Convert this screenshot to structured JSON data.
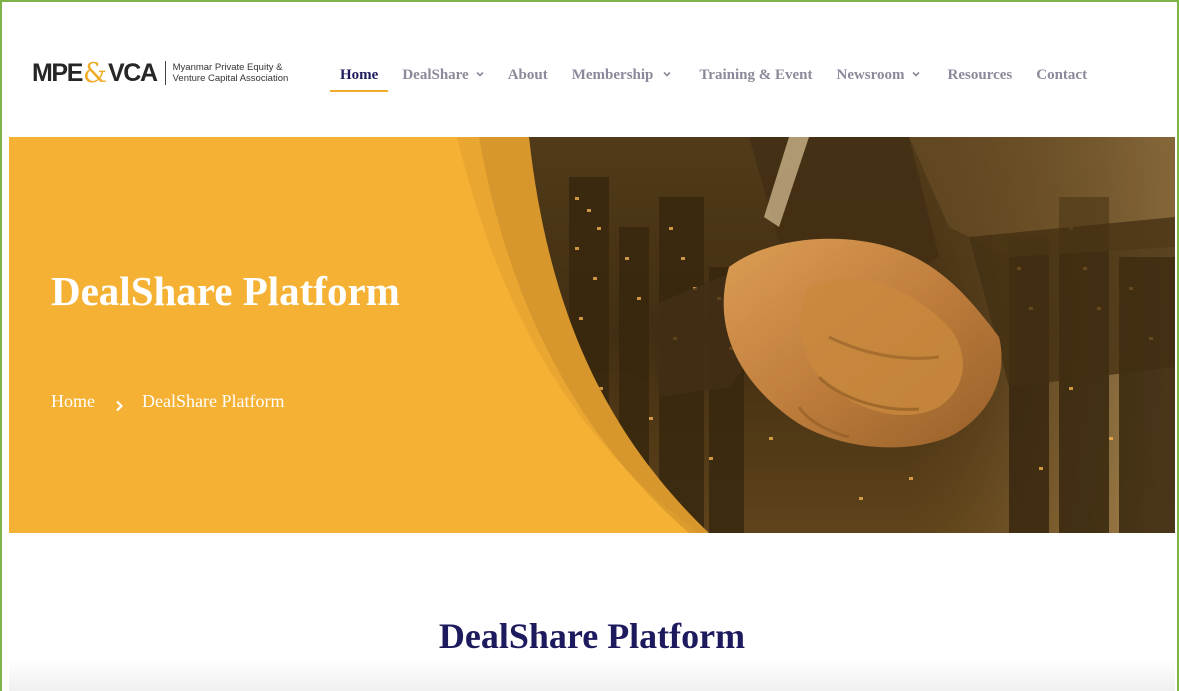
{
  "header": {
    "logo": {
      "mark_left": "MPE",
      "mark_amp": "&",
      "mark_right": "VCA",
      "tagline_line1": "Myanmar Private Equity &",
      "tagline_line2": "Venture Capital Association"
    },
    "nav": [
      {
        "label": "Home",
        "active": true,
        "dropdown": false
      },
      {
        "label": "DealShare",
        "active": false,
        "dropdown": true
      },
      {
        "label": "About",
        "active": false,
        "dropdown": false
      },
      {
        "label": "Membership",
        "active": false,
        "dropdown": true
      },
      {
        "label": "Training & Event",
        "active": false,
        "dropdown": false
      },
      {
        "label": "Newsroom",
        "active": false,
        "dropdown": true
      },
      {
        "label": "Resources",
        "active": false,
        "dropdown": false
      },
      {
        "label": "Contact",
        "active": false,
        "dropdown": false
      }
    ]
  },
  "hero": {
    "title": "DealShare Platform",
    "breadcrumb": {
      "home": "Home",
      "current": "DealShare Platform",
      "separator_icon": "chevron-right-icon"
    },
    "image_subject": "handshake-over-city-photo"
  },
  "content": {
    "title": "DealShare Platform"
  },
  "colors": {
    "accent": "#f5b133",
    "nav_active": "#1d1b5e",
    "nav_inactive": "#8a8a9a",
    "frame_border": "#7cb447",
    "heading": "#1d1b5e"
  }
}
